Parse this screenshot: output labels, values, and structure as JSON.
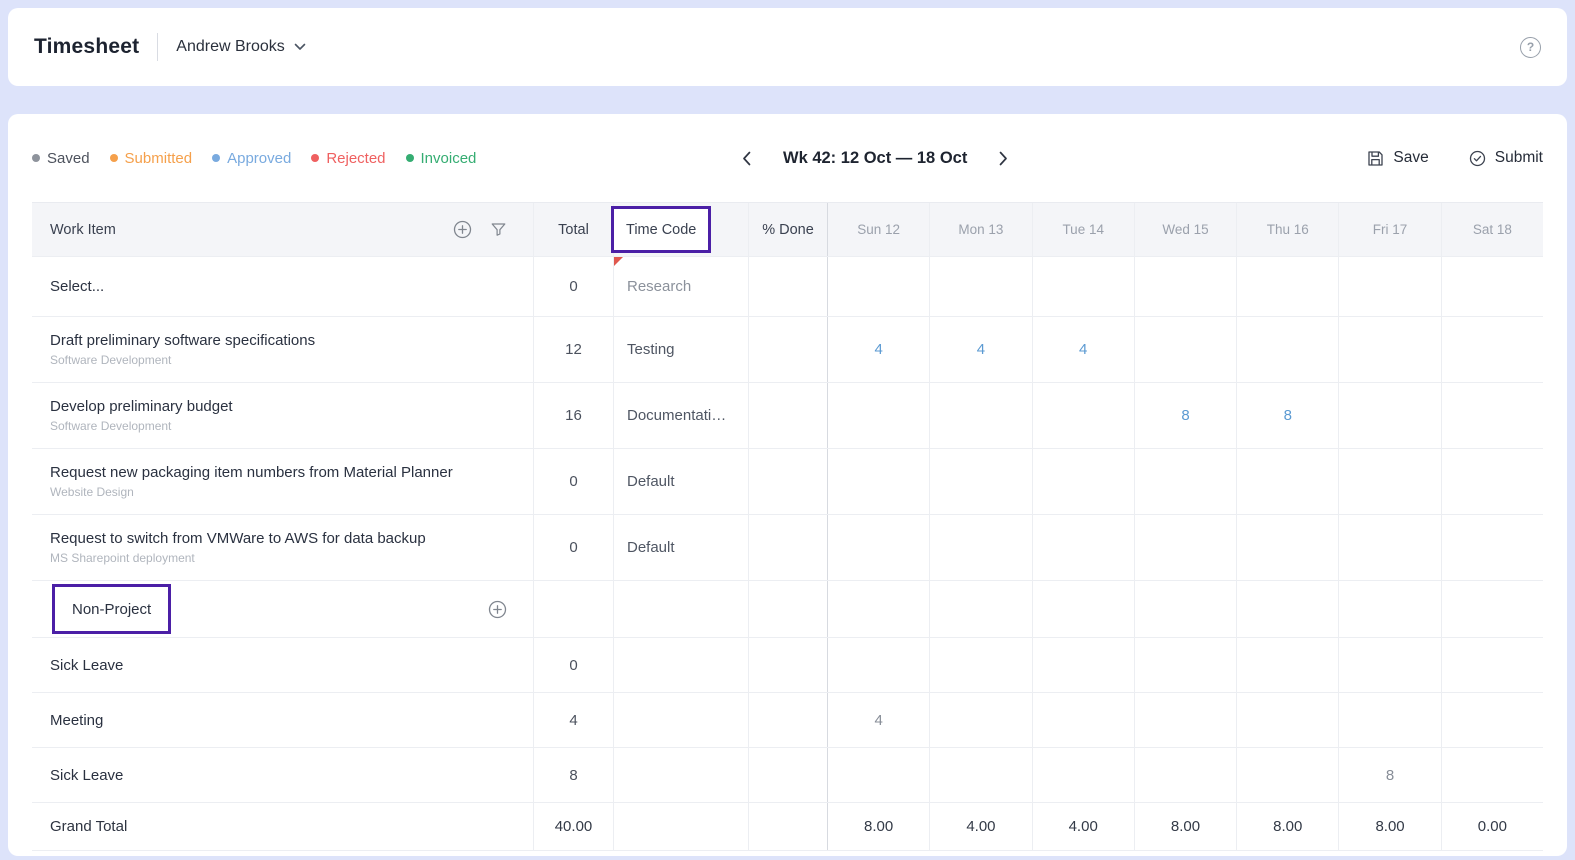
{
  "header": {
    "title": "Timesheet",
    "user": "Andrew Brooks"
  },
  "toolbar": {
    "legend": [
      {
        "label": "Saved",
        "dot": "#8e939c",
        "text": "#4d525d"
      },
      {
        "label": "Submitted",
        "dot": "#f5a04b",
        "text": "#f5a04b"
      },
      {
        "label": "Approved",
        "dot": "#79aadf",
        "text": "#79aadf"
      },
      {
        "label": "Rejected",
        "dot": "#ef6060",
        "text": "#ef6060"
      },
      {
        "label": "Invoiced",
        "dot": "#35ad72",
        "text": "#35ad72"
      }
    ],
    "week_label": "Wk 42: 12 Oct — 18 Oct",
    "save_label": "Save",
    "submit_label": "Submit"
  },
  "table": {
    "headers": {
      "work_item": "Work Item",
      "total": "Total",
      "time_code": "Time Code",
      "done": "% Done",
      "days": [
        "Sun 12",
        "Mon 13",
        "Tue 14",
        "Wed 15",
        "Thu 16",
        "Fri 17",
        "Sat 18"
      ]
    },
    "rows": [
      {
        "kind": "select",
        "title": "Select...",
        "total": "0",
        "time_code": "Research",
        "dirty": true,
        "days": [
          "",
          "",
          "",
          "",
          "",
          "",
          ""
        ]
      },
      {
        "kind": "project",
        "title": "Draft preliminary software specifications",
        "subtitle": "Software Development",
        "total": "12",
        "time_code": "Testing",
        "days": [
          "4",
          "4",
          "4",
          "",
          "",
          "",
          ""
        ]
      },
      {
        "kind": "project",
        "title": "Develop preliminary budget",
        "subtitle": "Software Development",
        "total": "16",
        "time_code": "Documentati…",
        "days": [
          "",
          "",
          "",
          "8",
          "8",
          "",
          ""
        ]
      },
      {
        "kind": "project",
        "title": "Request new packaging item numbers from Material Planner",
        "subtitle": "Website Design",
        "total": "0",
        "time_code": "Default",
        "days": [
          "",
          "",
          "",
          "",
          "",
          "",
          ""
        ]
      },
      {
        "kind": "project",
        "title": "Request to switch from VMWare to AWS for data backup",
        "subtitle": "MS Sharepoint deployment",
        "total": "0",
        "time_code": "Default",
        "days": [
          "",
          "",
          "",
          "",
          "",
          "",
          ""
        ]
      },
      {
        "kind": "section",
        "title": "Non-Project",
        "annotated": true
      },
      {
        "kind": "simple",
        "title": "Sick Leave",
        "total": "0",
        "days": [
          "",
          "",
          "",
          "",
          "",
          "",
          ""
        ]
      },
      {
        "kind": "simple",
        "title": "Meeting",
        "total": "4",
        "days": [
          "4",
          "",
          "",
          "",
          "",
          "",
          ""
        ]
      },
      {
        "kind": "simple",
        "title": "Sick Leave",
        "total": "8",
        "days": [
          "",
          "",
          "",
          "",
          "",
          "8",
          ""
        ]
      },
      {
        "kind": "total",
        "title": "Grand Total",
        "total": "40.00",
        "days": [
          "8.00",
          "4.00",
          "4.00",
          "8.00",
          "8.00",
          "8.00",
          "0.00"
        ]
      }
    ]
  },
  "colors": {
    "annotation": "#4b1fa6",
    "value_blue": "#5b9ad2",
    "value_gray": "#878d97",
    "background": "#dde3fa"
  }
}
